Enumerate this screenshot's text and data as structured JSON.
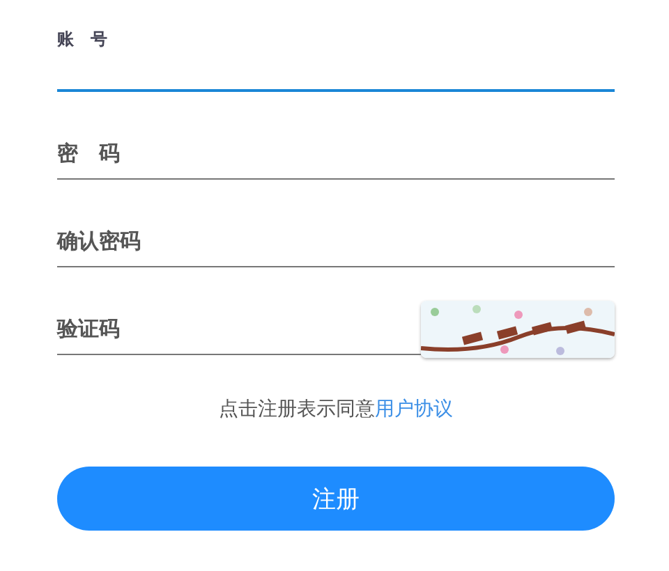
{
  "fields": [
    {
      "label": "账　号",
      "focused": true
    },
    {
      "label": "密　码",
      "focused": false
    },
    {
      "label": "确认密码",
      "focused": false
    },
    {
      "label": "验证码",
      "focused": false
    }
  ],
  "agreement": {
    "text": "点击注册表示同意",
    "link": "用户协议"
  },
  "submit": {
    "label": "注册"
  }
}
